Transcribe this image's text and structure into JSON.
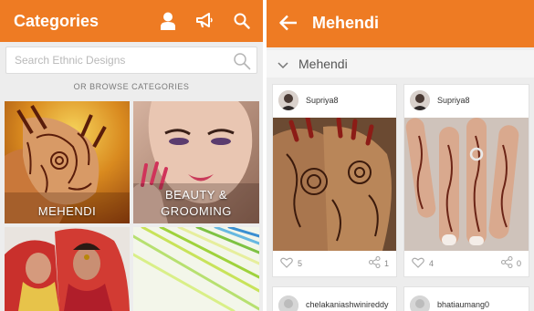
{
  "left": {
    "title": "Categories",
    "icons": [
      "user-icon",
      "megaphone-icon",
      "search-icon"
    ],
    "search": {
      "placeholder": "Search Ethnic Designs"
    },
    "browse_label": "OR BROWSE CATEGORIES",
    "categories": [
      {
        "label": "MEHENDI"
      },
      {
        "label_line1": "BEAUTY &",
        "label_line2": "GROOMING"
      },
      {
        "label": ""
      },
      {
        "label": ""
      }
    ]
  },
  "right": {
    "title": "Mehendi",
    "filter_label": "Mehendi",
    "posts": [
      {
        "user": "Supriya8",
        "likes": "5",
        "shares": "1"
      },
      {
        "user": "Supriya8",
        "likes": "4",
        "shares": "0"
      },
      {
        "user": "chelakaniashwinireddy"
      },
      {
        "user": "bhatiaumang0"
      }
    ]
  },
  "colors": {
    "accent": "#ee7b23",
    "background": "#ededed"
  }
}
